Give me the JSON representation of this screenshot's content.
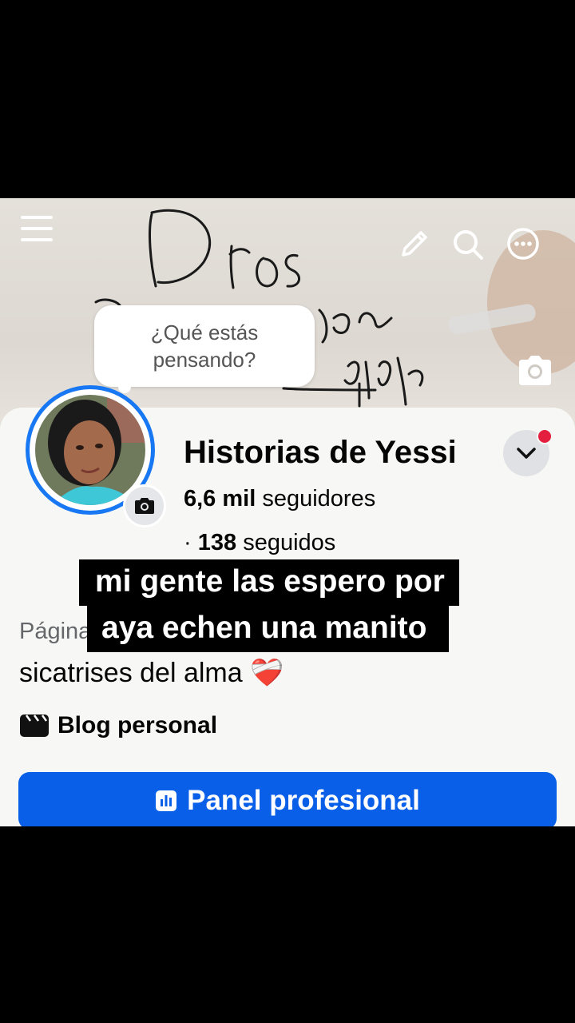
{
  "cover": {
    "composer_prompt": "¿Qué estás pensando?",
    "icons": [
      "menu-icon",
      "pencil-icon",
      "search-icon",
      "more-icon",
      "camera-icon"
    ]
  },
  "profile": {
    "name": "Historias de Yessi",
    "followers_count": "6,6 mil",
    "followers_label": "seguidores",
    "following_prefix": "·",
    "following_count": "138",
    "following_label": "seguidos",
    "page_type_partial": "Página",
    "bio": "sicatrises del alma",
    "bio_emoji": "❤️‍🩹",
    "category": "Blog personal",
    "category_icon": "clapperboard-icon",
    "professional_button": "Panel profesional",
    "professional_icon": "dashboard-icon",
    "notification_dot": true
  },
  "captions": {
    "line1": "mi gente las espero por",
    "line2": "aya echen una manito"
  },
  "colors": {
    "accent": "#0a5fe8",
    "avatar_ring": "#1877f2",
    "notification": "#e41e3f",
    "letterbox": "#000000"
  }
}
